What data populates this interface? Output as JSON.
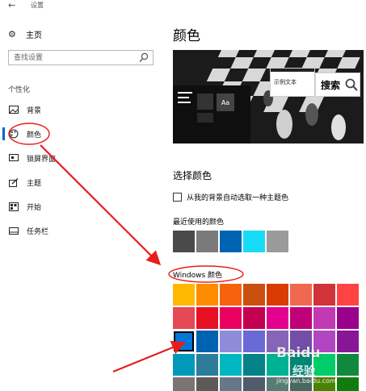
{
  "titlebar": {
    "back_icon": "back-arrow-icon",
    "title": "设置"
  },
  "sidebar": {
    "home_label": "主页",
    "search_placeholder": "查找设置",
    "section_label": "个性化",
    "items": [
      {
        "label": "背景",
        "icon": "picture-icon"
      },
      {
        "label": "颜色",
        "icon": "palette-icon",
        "selected": true
      },
      {
        "label": "锁屏界面",
        "icon": "lock-screen-icon"
      },
      {
        "label": "主题",
        "icon": "theme-brush-icon"
      },
      {
        "label": "开始",
        "icon": "start-grid-icon"
      },
      {
        "label": "任务栏",
        "icon": "taskbar-icon"
      }
    ]
  },
  "main": {
    "page_title": "颜色",
    "preview": {
      "tile_text": "Aa",
      "sample_text": "示例文本"
    },
    "search_callout": "搜索",
    "choose_heading": "选择颜色",
    "auto_pick_label": "从我的背景自动选取一种主题色",
    "auto_pick_checked": false,
    "recent_label": "最近使用的颜色",
    "recent_colors": [
      "#4a4a4a",
      "#7a7a7a",
      "#0063b1",
      "#18dcf5",
      "#9a9a9a"
    ],
    "windows_colors_label": "Windows 颜色",
    "windows_colors": [
      [
        "#ffb900",
        "#ff8c00",
        "#f7630c",
        "#ca5010",
        "#da3b01",
        "#ef6950",
        "#d13438",
        "#ff4343"
      ],
      [
        "#e74856",
        "#e81123",
        "#ea005e",
        "#c30052",
        "#e3008c",
        "#bf0077",
        "#c239b3",
        "#9a0089"
      ],
      [
        "#0078d7",
        "#0063b1",
        "#8e8cd8",
        "#6b69d6",
        "#8764b8",
        "#744da9",
        "#b146c2",
        "#881798"
      ],
      [
        "#0099bc",
        "#2d7d9a",
        "#00b7c3",
        "#038387",
        "#00b294",
        "#018574",
        "#00cc6a",
        "#10893e"
      ],
      [
        "#7a7574",
        "#5d5a58",
        "#68768a",
        "#515c6b",
        "#567c73",
        "#486860",
        "#498205",
        "#107c10"
      ]
    ],
    "selected_color": "#0078d7"
  },
  "annotation_color": "#e81c1c",
  "watermark": {
    "logo": "Baidu",
    "sub": "经验",
    "url": "jingyan.baidu.com"
  }
}
